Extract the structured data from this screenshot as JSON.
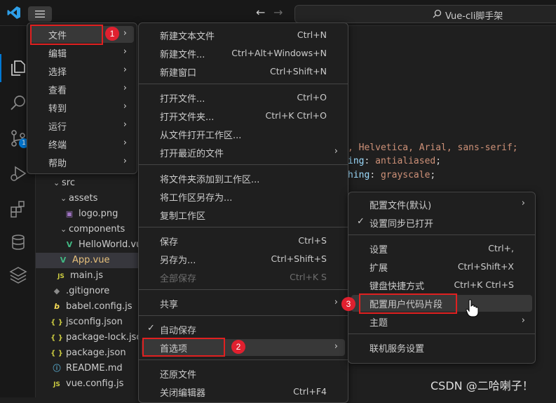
{
  "titlebar": {
    "search_text": "Vue-cli脚手架"
  },
  "activity": {
    "scm_badge": "1"
  },
  "explorer": {
    "items": [
      {
        "label": "src",
        "icon": "folder-open"
      },
      {
        "label": "assets",
        "icon": "folder-open"
      },
      {
        "label": "logo.png",
        "icon": "image-icon"
      },
      {
        "label": "components",
        "icon": "folder-open"
      },
      {
        "label": "HelloWorld.vue",
        "icon": "vue-icon"
      },
      {
        "label": "App.vue",
        "icon": "vue-icon",
        "selected": true
      },
      {
        "label": "main.js",
        "icon": "js-icon",
        "badge": "JS"
      },
      {
        "label": ".gitignore",
        "icon": "gitignore-icon"
      },
      {
        "label": "babel.config.js",
        "icon": "babel-icon"
      },
      {
        "label": "jsconfig.json",
        "icon": "json-icon",
        "badge": "{ }"
      },
      {
        "label": "package-lock.json",
        "icon": "json-icon",
        "badge": "{ }"
      },
      {
        "label": "package.json",
        "icon": "json-icon",
        "badge": "{ }"
      },
      {
        "label": "README.md",
        "icon": "info-icon"
      },
      {
        "label": "vue.config.js",
        "icon": "js-icon",
        "badge": "JS"
      }
    ]
  },
  "code": {
    "line1": ", Helvetica, Arial, sans-serif;",
    "line2_prop": "ing",
    "line2_val": "antialiased",
    "line3_prop": "hing",
    "line3_val": "grayscale"
  },
  "menubar": {
    "items": [
      "文件",
      "编辑",
      "选择",
      "查看",
      "转到",
      "运行",
      "终端",
      "帮助"
    ]
  },
  "file_menu": {
    "new_text_file": {
      "label": "新建文本文件",
      "key": "Ctrl+N"
    },
    "new_file": {
      "label": "新建文件...",
      "key": "Ctrl+Alt+Windows+N"
    },
    "new_window": {
      "label": "新建窗口",
      "key": "Ctrl+Shift+N"
    },
    "open_file": {
      "label": "打开文件...",
      "key": "Ctrl+O"
    },
    "open_folder": {
      "label": "打开文件夹...",
      "key": "Ctrl+K Ctrl+O"
    },
    "open_workspace": {
      "label": "从文件打开工作区..."
    },
    "open_recent": {
      "label": "打开最近的文件"
    },
    "add_folder": {
      "label": "将文件夹添加到工作区..."
    },
    "save_workspace_as": {
      "label": "将工作区另存为..."
    },
    "duplicate_workspace": {
      "label": "复制工作区"
    },
    "save": {
      "label": "保存",
      "key": "Ctrl+S"
    },
    "save_as": {
      "label": "另存为...",
      "key": "Ctrl+Shift+S"
    },
    "save_all": {
      "label": "全部保存",
      "key": "Ctrl+K S"
    },
    "share": {
      "label": "共享"
    },
    "auto_save": {
      "label": "自动保存"
    },
    "preferences": {
      "label": "首选项"
    },
    "revert_file": {
      "label": "还原文件"
    },
    "close_editor": {
      "label": "关闭编辑器",
      "key": "Ctrl+F4"
    }
  },
  "pref_menu": {
    "profile": {
      "label": "配置文件(默认)"
    },
    "settings_sync": {
      "label": "设置同步已打开"
    },
    "settings": {
      "label": "设置",
      "key": "Ctrl+,"
    },
    "extensions": {
      "label": "扩展",
      "key": "Ctrl+Shift+X"
    },
    "keyboard_shortcuts": {
      "label": "键盘快捷方式",
      "key": "Ctrl+K Ctrl+S"
    },
    "user_snippets": {
      "label": "配置用户代码片段"
    },
    "theme": {
      "label": "主题"
    },
    "online_services": {
      "label": "联机服务设置"
    }
  },
  "annotations": {
    "step1": "1",
    "step2": "2",
    "step3": "3"
  },
  "watermark": "CSDN @二哈喇子！",
  "colors": {
    "accent": "#0078d4",
    "annotation_red": "#e02020",
    "vue_green": "#41b883",
    "js_yellow": "#cbcb41"
  }
}
